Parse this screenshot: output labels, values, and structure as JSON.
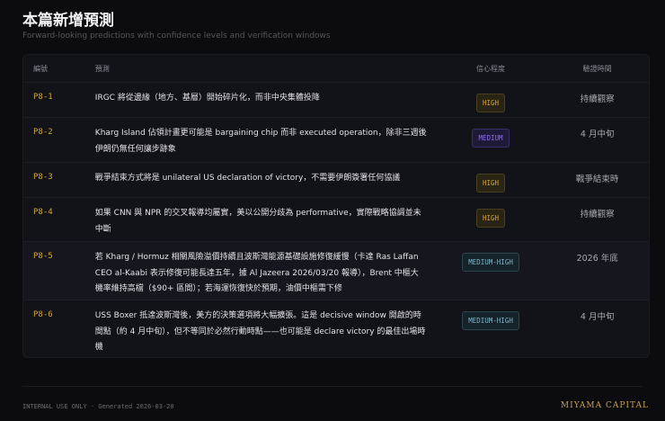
{
  "header": {
    "title": "本篇新增預測",
    "subtitle": "Forward-looking predictions with confidence levels and verification windows"
  },
  "table": {
    "columns": [
      "編號",
      "預測",
      "信心程度",
      "驗證時間"
    ],
    "rows": [
      {
        "id": "P8-1",
        "prediction": "IRGC 將從邊緣（地方、基層）開始碎片化，而非中央集體投降",
        "confidence": "HIGH",
        "window": "持續觀察"
      },
      {
        "id": "P8-2",
        "prediction": "Kharg Island 佔領計畫更可能是 bargaining chip 而非 executed operation，除非三週後伊朗仍無任何讓步跡象",
        "confidence": "MEDIUM",
        "window": "4 月中旬"
      },
      {
        "id": "P8-3",
        "prediction": "戰爭結束方式將是 unilateral US declaration of victory，不需要伊朗簽署任何協議",
        "confidence": "HIGH",
        "window": "戰爭結束時"
      },
      {
        "id": "P8-4",
        "prediction": "如果 CNN 與 NPR 的交叉報導均屬實，美以公開分歧為 performative，實際戰略協調並未中斷",
        "confidence": "HIGH",
        "window": "持續觀察"
      },
      {
        "id": "P8-5",
        "prediction": "若 Kharg / Hormuz 相關風險溢價持續且波斯灣能源基礎設施修復緩慢（卡達 Ras Laffan CEO al-Kaabi 表示修復可能長達五年，據 Al Jazeera 2026/03/20 報導），Brent 中樞大機率維持高檔（$90+ 區間）；若海運恢復快於預期，油價中樞需下修",
        "confidence": "MEDIUM-HIGH",
        "window": "2026 年底"
      },
      {
        "id": "P8-6",
        "prediction": "USS Boxer 抵達波斯灣後，美方的決策選項將大幅擴張。這是 decisive window 開啟的時間點（約 4 月中旬），但不等同於必然行動時點——也可能是 declare victory 的最佳出場時機",
        "confidence": "MEDIUM-HIGH",
        "window": "4 月中旬"
      }
    ]
  },
  "footer": {
    "left": "INTERNAL USE ONLY · Generated 2026-03-20",
    "brand": "MIYAMA CAPITAL"
  }
}
